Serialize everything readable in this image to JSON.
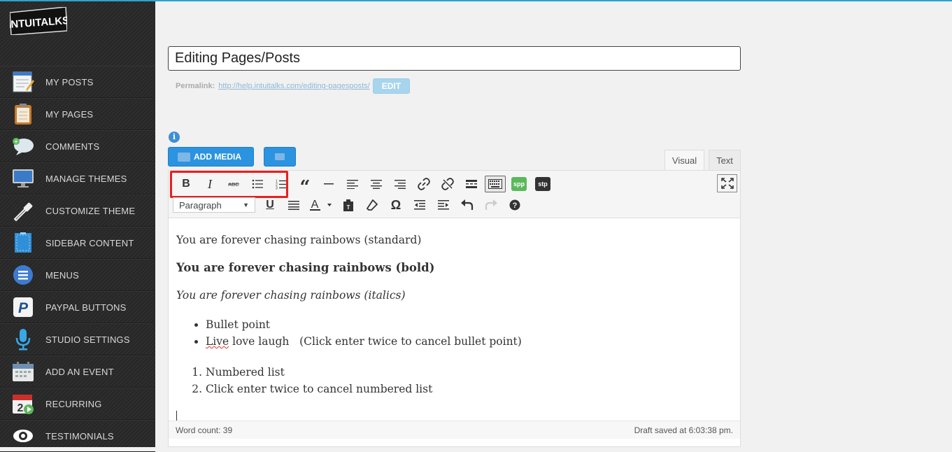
{
  "brand": {
    "logo_text": "INTUITALKS"
  },
  "sidebar": {
    "items": [
      {
        "label": "MY POSTS",
        "icon": "notepad-icon"
      },
      {
        "label": "MY PAGES",
        "icon": "clipboard-icon"
      },
      {
        "label": "COMMENTS",
        "icon": "speech-bubble-icon"
      },
      {
        "label": "MANAGE THEMES",
        "icon": "monitor-icon"
      },
      {
        "label": "CUSTOMIZE THEME",
        "icon": "eyedropper-icon"
      },
      {
        "label": "SIDEBAR CONTENT",
        "icon": "sidebar-icon"
      },
      {
        "label": "MENUS",
        "icon": "menu-icon"
      },
      {
        "label": "PAYPAL BUTTONS",
        "icon": "paypal-icon"
      },
      {
        "label": "STUDIO SETTINGS",
        "icon": "microphone-icon"
      },
      {
        "label": "ADD AN EVENT",
        "icon": "calendar-icon"
      },
      {
        "label": "RECURRING",
        "icon": "recurring-calendar-icon"
      },
      {
        "label": "TESTIMONIALS",
        "icon": "eye-icon"
      }
    ]
  },
  "post": {
    "title": "Editing Pages/Posts",
    "permalink_label": "Permalink:",
    "permalink_url": "http://help.intuitalks.com/editing-pagesposts/",
    "edit_label": "EDIT"
  },
  "media": {
    "add_media_label": "ADD MEDIA"
  },
  "tabs": {
    "visual": "Visual",
    "text": "Text"
  },
  "toolbar": {
    "format_value": "Paragraph",
    "spp_label": "spp",
    "stp_label": "stp"
  },
  "content": {
    "standard": "You are forever chasing rainbows (standard)",
    "bold": "You are forever chasing rainbows (bold)",
    "italics": "You are forever chasing rainbows (italics)",
    "bullets": [
      "Bullet point",
      "Live love laugh   (Click enter twice to cancel bullet point)"
    ],
    "bullet2_word": "Live",
    "bullet2_rest": " love laugh   (Click enter twice to cancel bullet point)",
    "numbered": [
      "Numbered list",
      "Click enter twice to cancel numbered list"
    ]
  },
  "status": {
    "word_count": "Word count: 39",
    "draft_saved": "Draft saved at 6:03:38 pm."
  },
  "colors": {
    "accent": "#2b93e0",
    "highlight": "#e8201f",
    "sidebar": "#2a2a2a"
  }
}
